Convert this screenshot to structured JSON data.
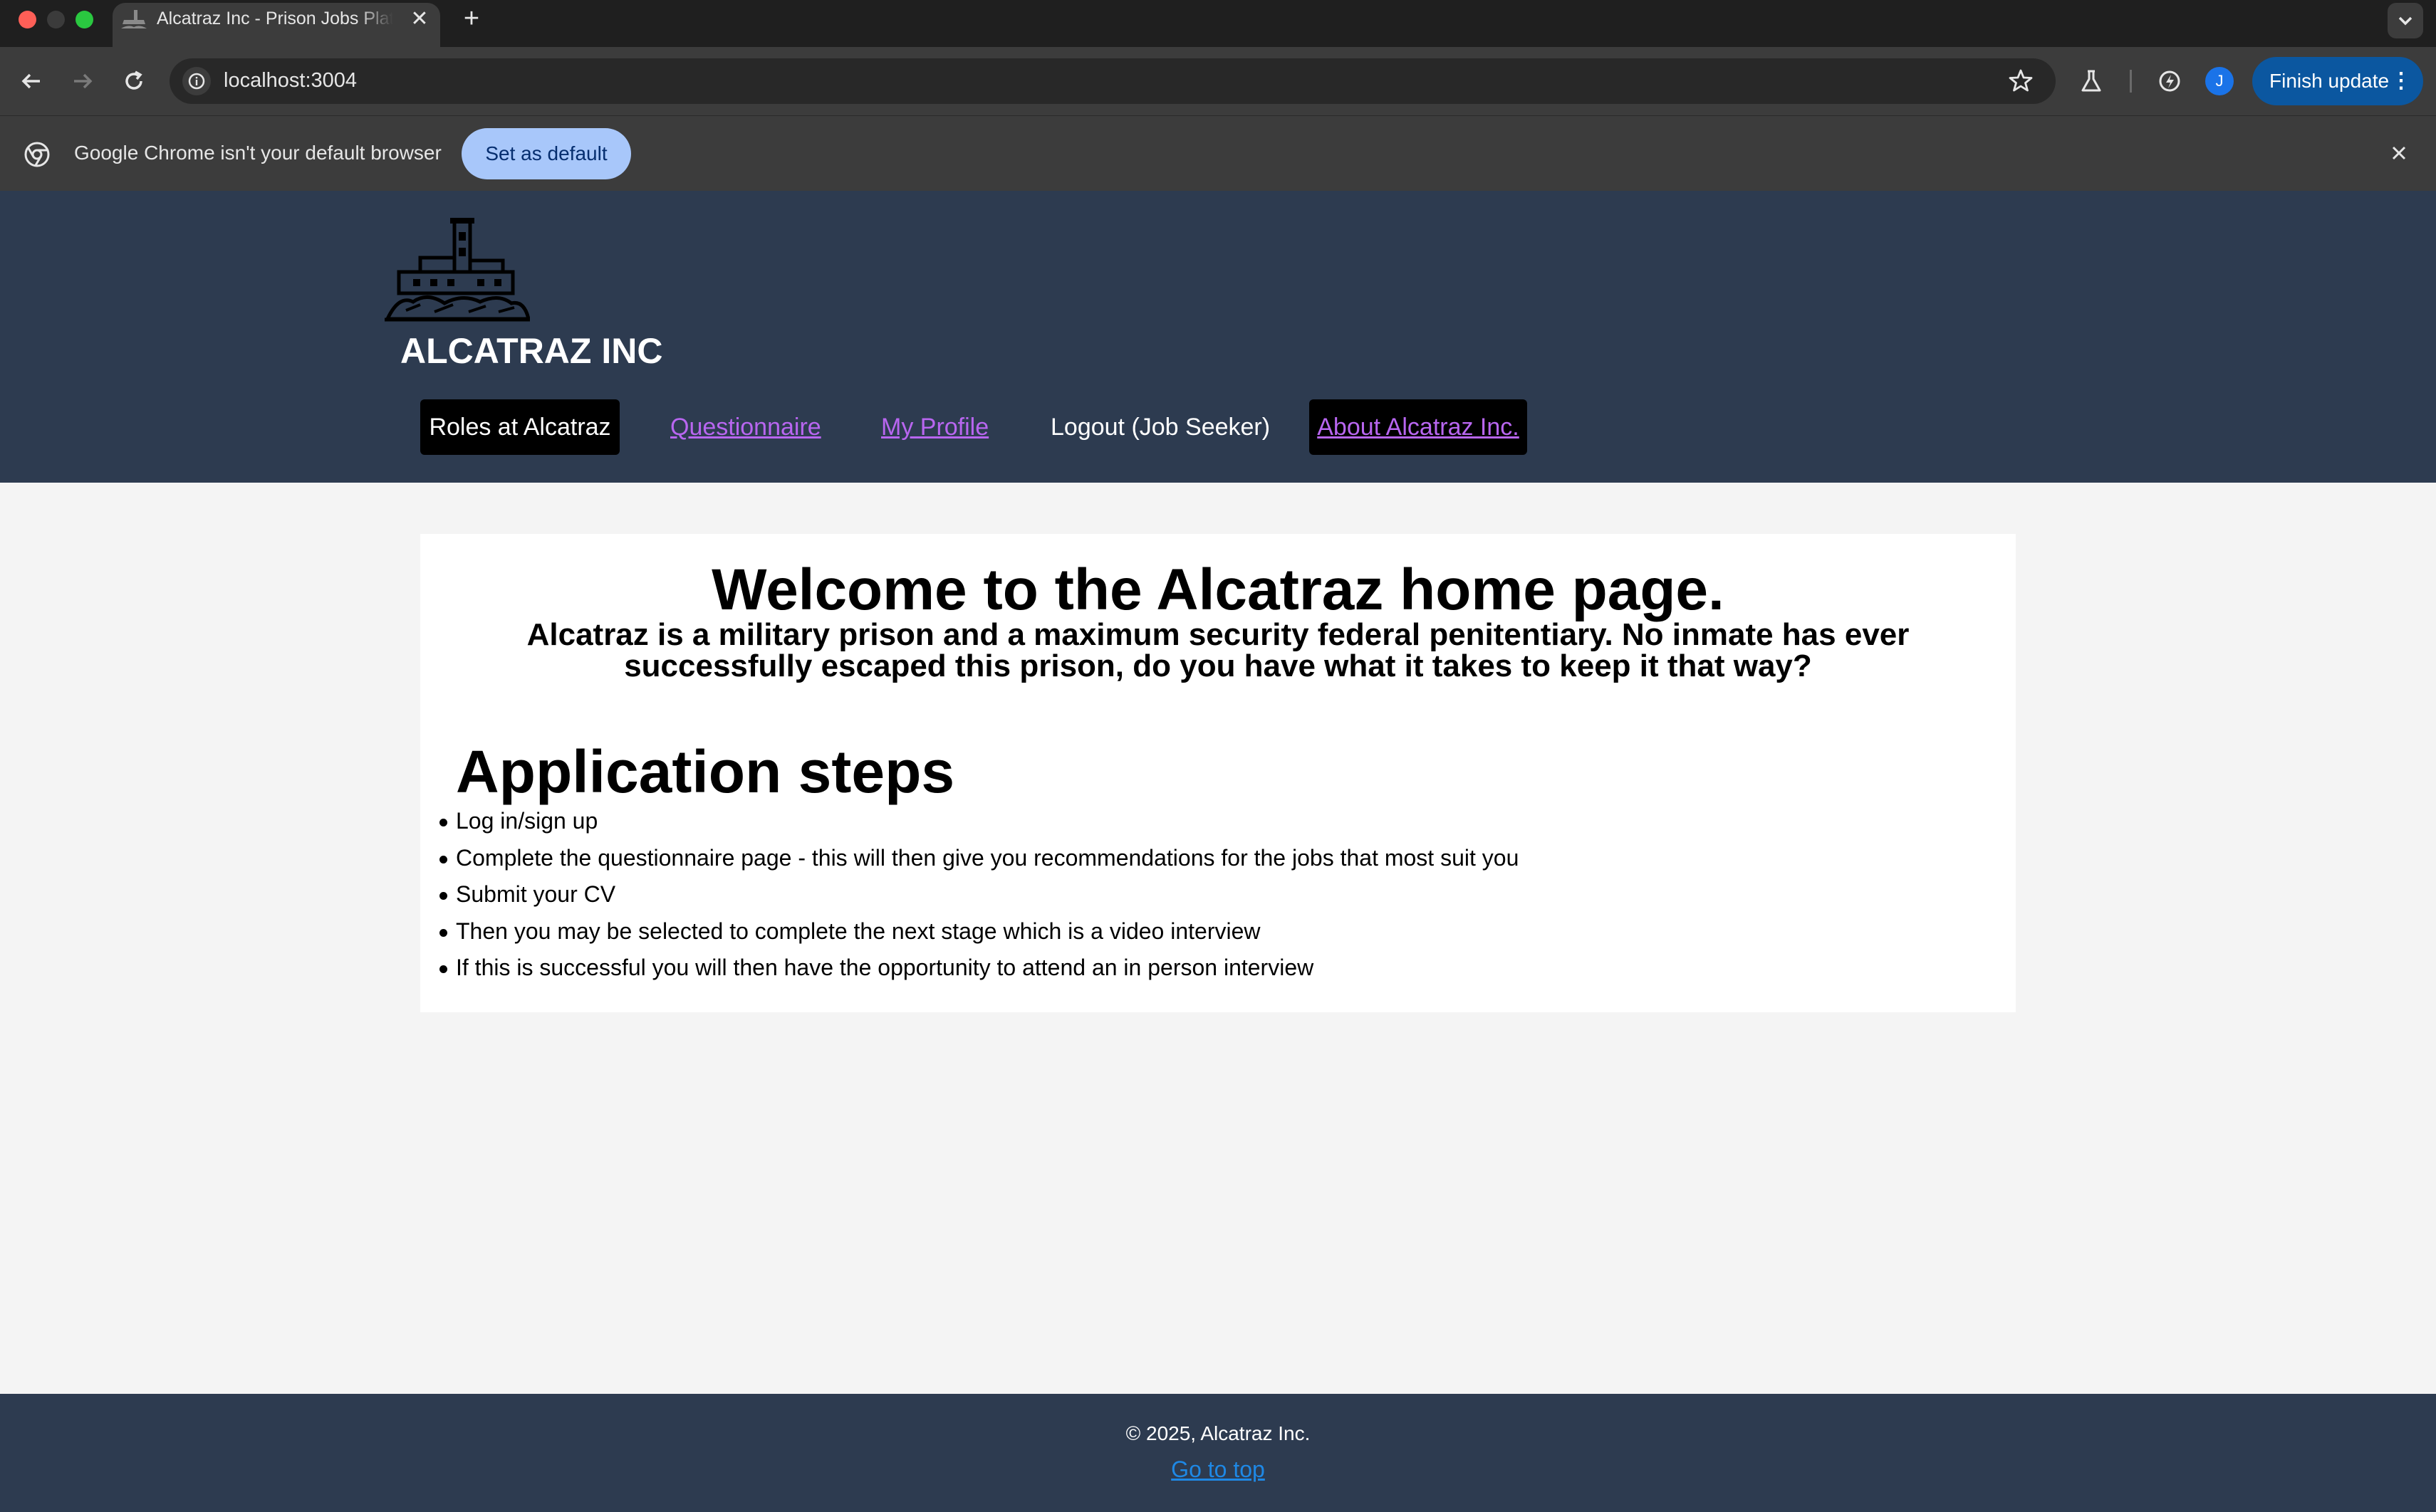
{
  "browser": {
    "tab_title": "Alcatraz Inc - Prison Jobs Platform",
    "url": "localhost:3004",
    "avatar_initial": "J",
    "finish_update_label": "Finish update",
    "infobar_message": "Google Chrome isn't your default browser",
    "set_default_label": "Set as default"
  },
  "header": {
    "brand": "ALCATRAZ INC",
    "nav": {
      "roles": "Roles at Alcatraz",
      "questionnaire": "Questionnaire",
      "profile": "My Profile",
      "logout": "Logout (Job Seeker)",
      "about": "About Alcatraz Inc."
    }
  },
  "main": {
    "welcome": "Welcome to the Alcatraz home page.",
    "intro": "Alcatraz is a military prison and a maximum security federal penitentiary. No inmate has ever successfully escaped this prison, do you have what it takes to keep it that way?",
    "steps_title": "Application steps",
    "steps": [
      "Log in/sign up",
      "Complete the questionnaire page - this will then give you recommendations for the jobs that most suit you",
      "Submit your CV",
      "Then you may be selected to complete the next stage which is a video interview",
      "If this is successful you will then have the opportunity to attend an in person interview"
    ]
  },
  "footer": {
    "copyright": "© 2025, Alcatraz Inc.",
    "go_top": "Go to top"
  }
}
